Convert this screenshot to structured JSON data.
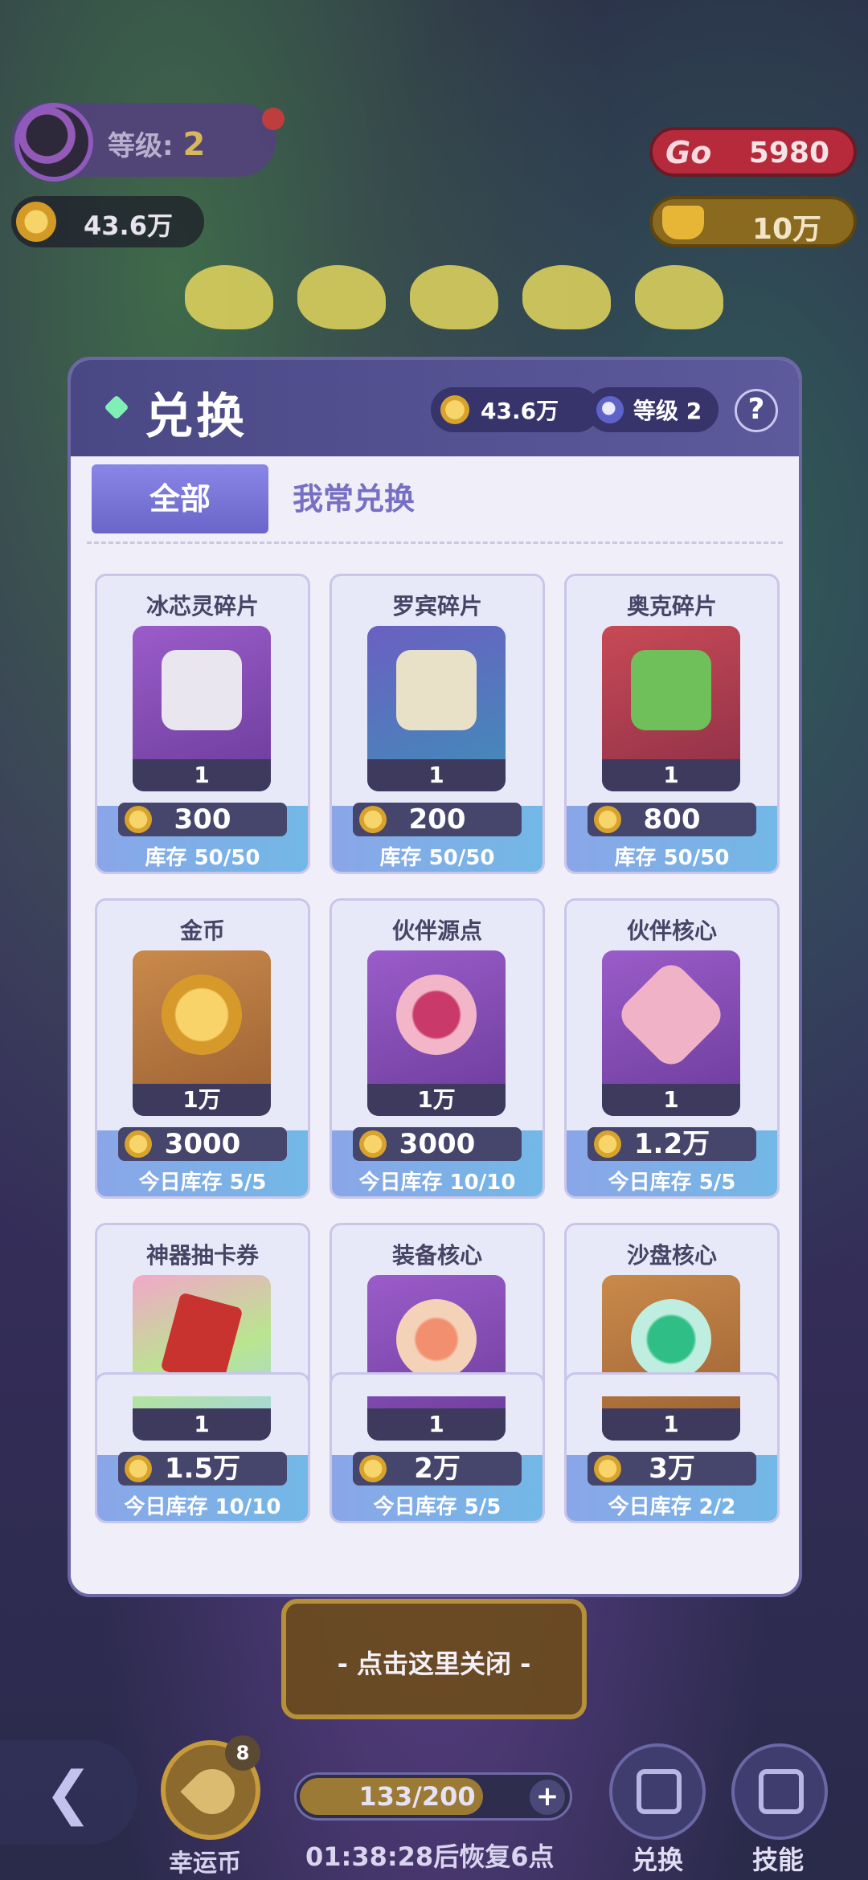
{
  "hud": {
    "level_label": "等级:",
    "level_value": "2",
    "coins": "43.6万",
    "go_label": "Go",
    "go_value": "5980",
    "wan_value": "10万"
  },
  "modal": {
    "title": "兑换",
    "coins": "43.6万",
    "level": "等级 2",
    "help": "?"
  },
  "tabs": [
    {
      "label": "全部",
      "active": true
    },
    {
      "label": "我常兑换",
      "active": false
    }
  ],
  "items": [
    {
      "name": "冰芯灵碎片",
      "qty": "1",
      "price": "300",
      "stock": "库存 50/50"
    },
    {
      "name": "罗宾碎片",
      "qty": "1",
      "price": "200",
      "stock": "库存 50/50"
    },
    {
      "name": "奥克碎片",
      "qty": "1",
      "price": "800",
      "stock": "库存 50/50"
    },
    {
      "name": "金币",
      "qty": "1万",
      "price": "3000",
      "stock": "今日库存 5/5"
    },
    {
      "name": "伙伴源点",
      "qty": "1万",
      "price": "3000",
      "stock": "今日库存 10/10"
    },
    {
      "name": "伙伴核心",
      "qty": "1",
      "price": "1.2万",
      "stock": "今日库存 5/5"
    },
    {
      "name": "神器抽卡券",
      "qty": "1",
      "price": "1.5万",
      "stock": "今日库存 10/10"
    },
    {
      "name": "装备核心",
      "qty": "1",
      "price": "2万",
      "stock": "今日库存 5/5"
    },
    {
      "name": "沙盘核心",
      "qty": "1",
      "price": "3万",
      "stock": "今日库存 2/2"
    }
  ],
  "close_hint": "- 点击这里关闭 -",
  "bottom": {
    "lucky_label": "幸运币",
    "lucky_badge": "8",
    "energy": "133/200",
    "energy_fraction": 0.665,
    "timer": "01:38:28后恢复6点",
    "exchange_label": "兑换",
    "skill_label": "技能"
  },
  "colors": {
    "header": "#4a4884",
    "tab_active": "#7a76d8",
    "tab_inactive_text": "#7670c4",
    "price_bg": "#46456c",
    "stock_bg": "#8aa6e8"
  },
  "icons": [
    "back-arrow-icon",
    "clover-icon",
    "plus-icon",
    "exchange-icon",
    "skill-icon",
    "coin-icon",
    "level-icon",
    "help-icon"
  ]
}
